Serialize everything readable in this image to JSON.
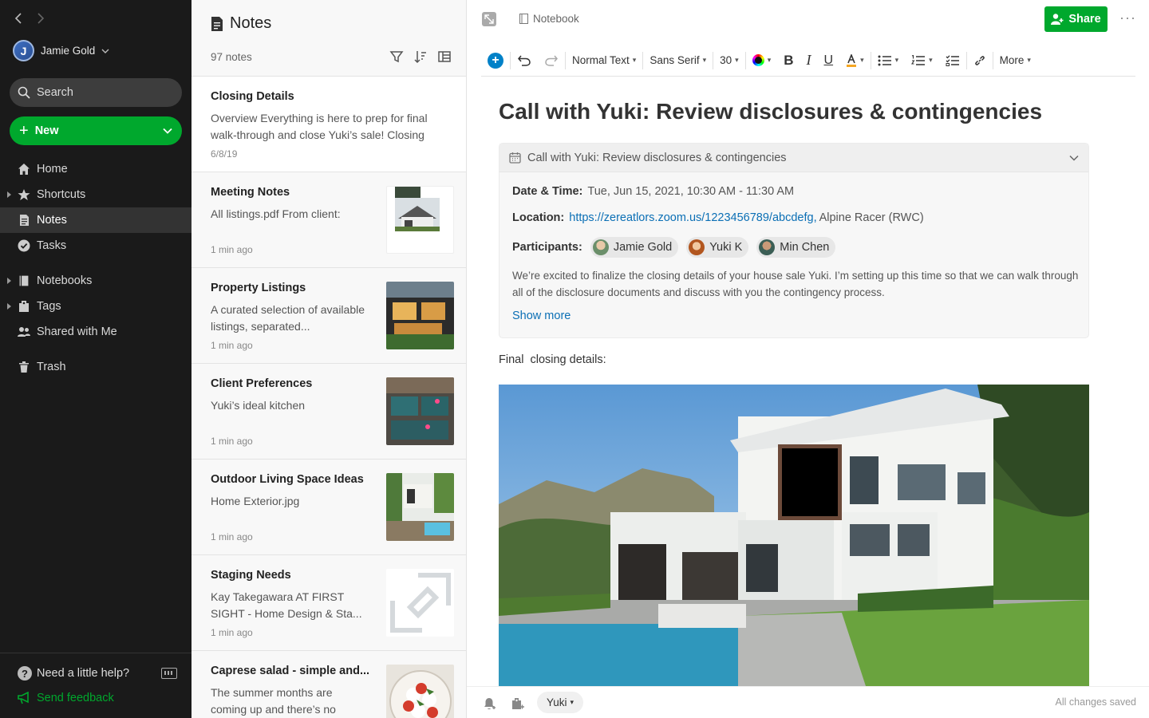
{
  "account": {
    "name": "Jamie Gold"
  },
  "search": {
    "label": "Search"
  },
  "new_button": {
    "label": "New"
  },
  "sidebar": {
    "items": [
      {
        "label": "Home",
        "icon": "home-icon"
      },
      {
        "label": "Shortcuts",
        "icon": "star-icon"
      },
      {
        "label": "Notes",
        "icon": "note-icon"
      },
      {
        "label": "Tasks",
        "icon": "check-circle-icon"
      },
      {
        "label": "Notebooks",
        "icon": "notebook-icon"
      },
      {
        "label": "Tags",
        "icon": "tag-icon"
      },
      {
        "label": "Shared with Me",
        "icon": "people-icon"
      },
      {
        "label": "Trash",
        "icon": "trash-icon"
      }
    ],
    "help_label": "Need a little help?",
    "feedback_label": "Send feedback"
  },
  "notelist": {
    "title": "Notes",
    "count": "97 notes",
    "notes": [
      {
        "title": "Closing Details",
        "snippet": "Overview Everything is here to prep for final walk-through and close Yuki’s sale! Closing",
        "date": "6/8/19"
      },
      {
        "title": "Meeting Notes",
        "snippet": "All listings.pdf From client:",
        "date": "1 min ago"
      },
      {
        "title": "Property Listings",
        "snippet": "A curated selection of available listings, separated...",
        "date": "1 min ago"
      },
      {
        "title": "Client Preferences",
        "snippet": "Yuki’s ideal kitchen",
        "date": "1 min ago"
      },
      {
        "title": "Outdoor Living Space Ideas",
        "snippet": "Home Exterior.jpg",
        "date": "1 min ago"
      },
      {
        "title": "Staging Needs",
        "snippet": "Kay Takegawara AT FIRST SIGHT - Home Design & Sta...",
        "date": "1 min ago"
      },
      {
        "title": "Caprese salad - simple and...",
        "snippet": "The summer months are coming up and  there’s no",
        "date": ""
      }
    ]
  },
  "editor": {
    "notebook": "Notebook",
    "share_label": "Share",
    "more_dots": "···",
    "toolbar": {
      "style": "Normal Text",
      "font": "Sans Serif",
      "size": "30",
      "more": "More"
    },
    "title": "Call with Yuki: Review disclosures & contingencies",
    "meeting": {
      "header": "Call with Yuki: Review disclosures & contingencies",
      "datetime_label": "Date & Time:",
      "datetime": "Tue, Jun 15, 2021, 10:30 AM - 11:30 AM",
      "location_label": "Location:",
      "location_link": "https://zereatlors.zoom.us/1223456789/abcdefg,",
      "location_text": "Alpine Racer (RWC)",
      "participants_label": "Participants:",
      "participants": [
        "Jamie Gold",
        "Yuki K",
        "Min Chen"
      ],
      "description": "We’re excited to finalize the closing details of your house sale Yuki. I’m setting up this time so that we can walk through all of the disclosure documents and discuss with you the contingency process.",
      "show_more": "Show more"
    },
    "body_label": "Final  closing details:",
    "tag": "Yuki",
    "status": "All changes saved"
  },
  "colors": {
    "accent_green": "#00a82d",
    "link_blue": "#0b6fb5",
    "sidebar_bg": "#1a1a1a"
  }
}
